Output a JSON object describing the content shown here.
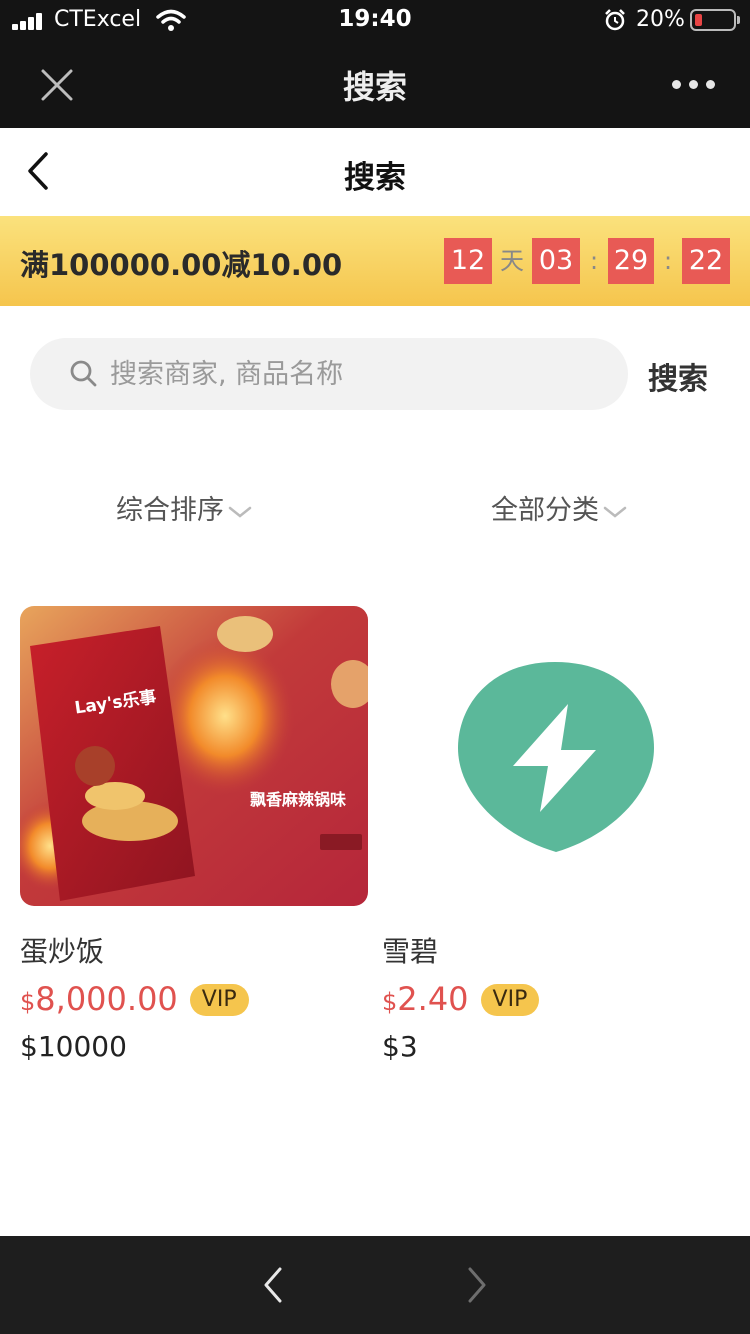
{
  "status_bar": {
    "carrier": "CTExcel",
    "time": "19:40",
    "battery_percent": "20%",
    "battery_level": 0.2,
    "icons": [
      "signal-icon",
      "wifi-icon",
      "alarm-icon",
      "battery-icon"
    ]
  },
  "webview_bar": {
    "title": "搜索",
    "icons": [
      "close-icon",
      "more-icon"
    ]
  },
  "header": {
    "title": "搜索",
    "icons": [
      "back-chevron-icon"
    ]
  },
  "promo": {
    "text": "满100000.00减10.00",
    "countdown": {
      "days": "12",
      "day_unit": "天",
      "hours": "03",
      "minutes": "29",
      "seconds": "22",
      "separator": ":"
    },
    "colors": {
      "banner": "#f5c54d",
      "countdown_box": "#e85a55"
    }
  },
  "search": {
    "placeholder": "搜索商家, 商品名称",
    "value": "",
    "button_label": "搜索"
  },
  "filters": [
    {
      "label": "综合排序"
    },
    {
      "label": "全部分类"
    }
  ],
  "products": [
    {
      "name": "蛋炒饭",
      "currency": "$",
      "price": "8,000.00",
      "badge": "VIP",
      "original_price": "$10000",
      "image": "lays-chips-product-photo",
      "image_text": {
        "brand": "Lay's乐事",
        "flavor": "飘香麻辣锅味"
      }
    },
    {
      "name": "雪碧",
      "currency": "$",
      "price": "2.40",
      "badge": "VIP",
      "original_price": "$3",
      "image": "lightning-bolt-placeholder-icon"
    }
  ],
  "colors": {
    "price": "#e0524f",
    "placeholder_icon": "#5bb89a",
    "vip_badge": "#f5c54d"
  },
  "bottom_bar": {
    "icons": [
      "nav-back-icon",
      "nav-forward-icon"
    ]
  }
}
